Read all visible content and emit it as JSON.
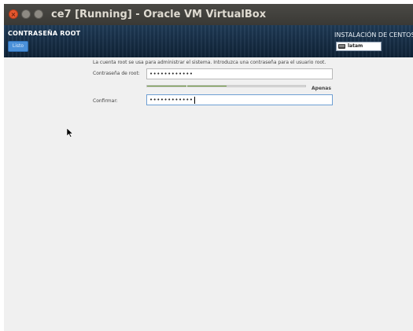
{
  "window": {
    "title": "ce7 [Running] - Oracle VM VirtualBox",
    "close_glyph": "×"
  },
  "header": {
    "spoke_title": "CONTRASEÑA ROOT",
    "done_label": "Listo",
    "install_title": "INSTALACIÓN DE CENTOS",
    "keyboard_layout": "latam",
    "keyboard_icon": "keyboard-icon"
  },
  "form": {
    "intro": "La cuenta root se usa para administrar el sistema. Introduzca una contraseña para el usuario root.",
    "password_label": "Contraseña de root:",
    "password_value": "••••••••••••",
    "strength_label": "Apenas",
    "strength_fraction": 0.5,
    "confirm_label": "Confirmar:",
    "confirm_value": "••••••••••••"
  },
  "colors": {
    "strength": "#6f9c3f",
    "header": "#1f3b57",
    "done_button": "#4a90d9"
  }
}
